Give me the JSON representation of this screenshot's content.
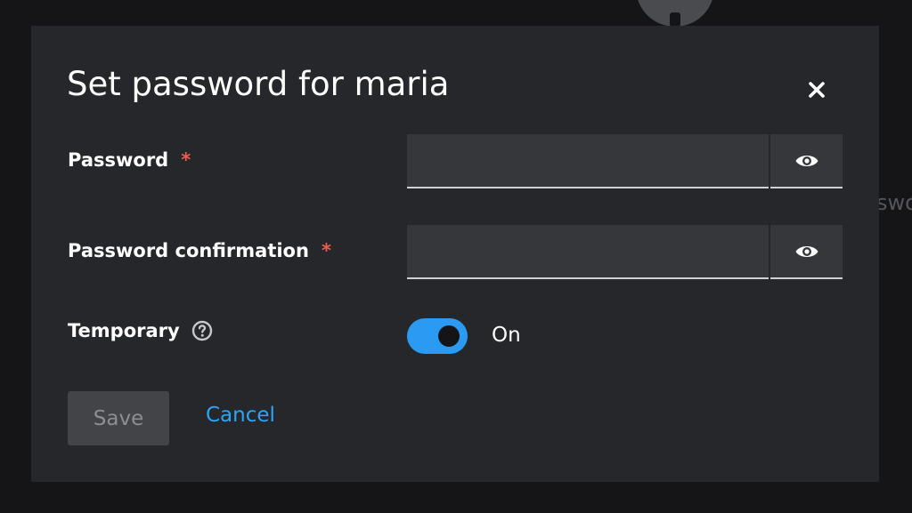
{
  "background": {
    "partial_text": "swo"
  },
  "modal": {
    "title": "Set password for maria",
    "close_icon": "close-icon"
  },
  "form": {
    "password": {
      "label": "Password",
      "required_mark": "*",
      "value": "",
      "reveal_icon": "eye-icon"
    },
    "password_confirmation": {
      "label": "Password confirmation",
      "required_mark": "*",
      "value": "",
      "reveal_icon": "eye-icon"
    },
    "temporary": {
      "label": "Temporary",
      "help_icon": "question-circle-icon",
      "state_label": "On",
      "checked": true
    }
  },
  "actions": {
    "save_label": "Save",
    "cancel_label": "Cancel"
  },
  "colors": {
    "modal_background": "#26272a",
    "page_background": "#151517",
    "accent": "#2b9af3",
    "link": "#2ba5f7",
    "required": "#ef5b4c",
    "disabled_button": "#434447"
  }
}
